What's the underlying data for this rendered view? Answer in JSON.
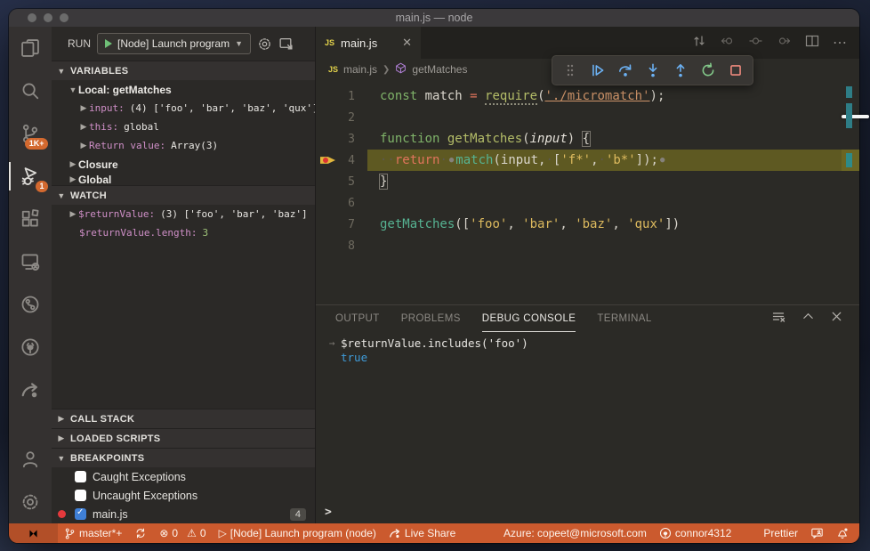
{
  "window": {
    "title": "main.js — node"
  },
  "colors": {
    "status_bar": "#cb5a2e",
    "badge": "#d3692f",
    "debug_blue": "#6cb2f5",
    "debug_green": "#83c98a",
    "debug_red": "#ef8a7e",
    "string_gold": "#ddba5e",
    "keyword_green": "#7fb369",
    "name_pink": "#cf8fc7",
    "result_blue": "#3f9bd8",
    "line_highlight": "#5e5922",
    "js_yellow": "#e2d24b",
    "symbol_purple": "#b180d7",
    "breakpoint_red": "#e5393c"
  },
  "activity_bar": {
    "scm_badge": "1K+",
    "debug_badge": "1"
  },
  "run_bar": {
    "run_label": "RUN",
    "config_label": "[Node] Launch program"
  },
  "sidebar": {
    "variables_header": "VARIABLES",
    "scope_label": "Local: getMatches",
    "variables": [
      {
        "name": "input:",
        "value": "(4) ['foo', 'bar', 'baz', 'qux']"
      },
      {
        "name": "this:",
        "value": "global"
      },
      {
        "name": "Return value:",
        "value": "Array(3)"
      }
    ],
    "closure_label": "Closure",
    "global_label": "Global",
    "watch_header": "WATCH",
    "watch": [
      {
        "name": "$returnValue:",
        "value": "(3) ['foo', 'bar', 'baz']"
      },
      {
        "name": "$returnValue.length:",
        "value": "3"
      }
    ],
    "call_stack_header": "CALL STACK",
    "loaded_scripts_header": "LOADED SCRIPTS",
    "breakpoints_header": "BREAKPOINTS",
    "breakpoints": [
      {
        "label": "Caught Exceptions"
      },
      {
        "label": "Uncaught Exceptions"
      },
      {
        "label": "main.js",
        "badge": "4"
      }
    ]
  },
  "editor": {
    "tab_label": "main.js",
    "tab_icon": "JS",
    "breadcrumb_file": "main.js",
    "breadcrumb_symbol": "getMatches",
    "code_lines": [
      {
        "num": "1",
        "tokens": [
          [
            "kw",
            "const"
          ],
          [
            "id",
            " match "
          ],
          [
            "op",
            "="
          ],
          [
            "id",
            " "
          ],
          [
            "fnu",
            "require"
          ],
          [
            "pun",
            "("
          ],
          [
            "strm",
            "'./micromatch'"
          ],
          [
            "pun",
            ");"
          ]
        ]
      },
      {
        "num": "2",
        "tokens": []
      },
      {
        "num": "3",
        "tokens": [
          [
            "kw",
            "function"
          ],
          [
            "id",
            " "
          ],
          [
            "fn",
            "getMatches"
          ],
          [
            "pun",
            "("
          ],
          [
            "itl",
            "input"
          ],
          [
            "pun",
            ") "
          ],
          [
            "brk",
            "{"
          ]
        ]
      },
      {
        "num": "4",
        "highlight": true,
        "breakpoint": true,
        "tokens": [
          [
            "ws",
            "··"
          ],
          [
            "op",
            "return"
          ],
          [
            "ws",
            "·"
          ],
          [
            "ibp",
            "●"
          ],
          [
            "call",
            "match"
          ],
          [
            "pun",
            "("
          ],
          [
            "id",
            "input"
          ],
          [
            "pun",
            ","
          ],
          [
            "ws",
            "·"
          ],
          [
            "pun",
            "["
          ],
          [
            "str",
            "'f*'"
          ],
          [
            "pun",
            ","
          ],
          [
            "ws",
            "·"
          ],
          [
            "str",
            "'b*'"
          ],
          [
            "pun",
            "]);"
          ],
          [
            "ibp",
            "●"
          ]
        ]
      },
      {
        "num": "5",
        "tokens": [
          [
            "brk",
            "}"
          ]
        ]
      },
      {
        "num": "6",
        "tokens": []
      },
      {
        "num": "7",
        "tokens": [
          [
            "call",
            "getMatches"
          ],
          [
            "pun",
            "(["
          ],
          [
            "str",
            "'foo'"
          ],
          [
            "pun",
            ", "
          ],
          [
            "str",
            "'bar'"
          ],
          [
            "pun",
            ", "
          ],
          [
            "str",
            "'baz'"
          ],
          [
            "pun",
            ", "
          ],
          [
            "str",
            "'qux'"
          ],
          [
            "pun",
            "])"
          ]
        ]
      },
      {
        "num": "8",
        "tokens": []
      }
    ]
  },
  "panel": {
    "tabs": [
      "OUTPUT",
      "PROBLEMS",
      "DEBUG CONSOLE",
      "TERMINAL"
    ],
    "active_tab": "DEBUG CONSOLE",
    "input_line": "$returnValue.includes('foo')",
    "input_arrow": "→",
    "result_line": "true",
    "prompt": ">"
  },
  "status_bar": {
    "branch": "master*+",
    "errors": "0",
    "warnings": "0",
    "launch": "[Node] Launch program (node)",
    "live_share": "Live Share",
    "azure": "Azure: copeet@microsoft.com",
    "account": "connor4312",
    "formatter": "Prettier"
  }
}
